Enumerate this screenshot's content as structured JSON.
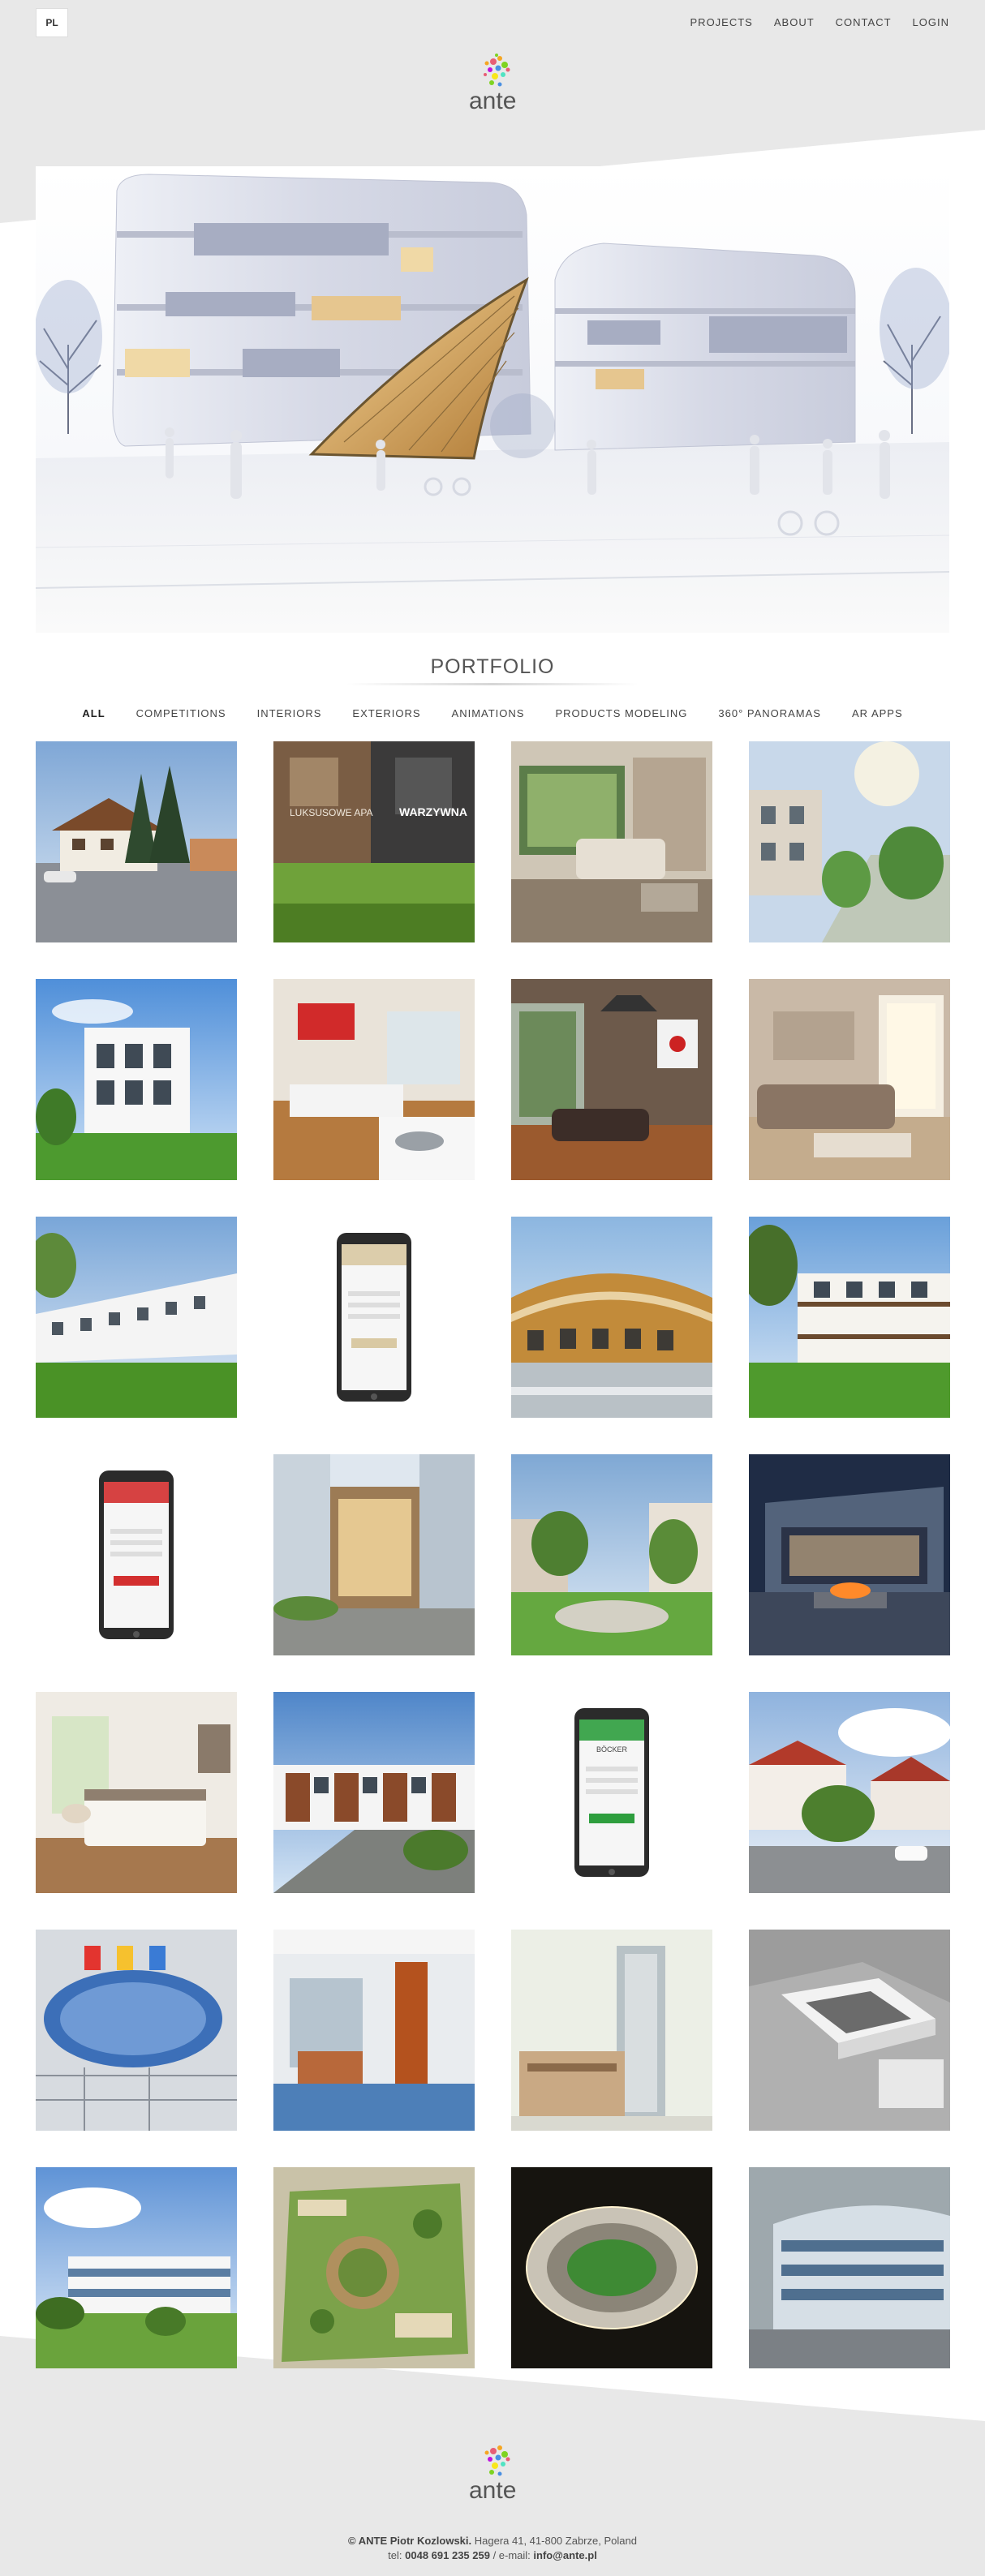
{
  "header": {
    "lang": "PL",
    "nav": [
      "PROJECTS",
      "ABOUT",
      "CONTACT",
      "LOGIN"
    ]
  },
  "logo": {
    "text": "ante"
  },
  "portfolio": {
    "title": "PORTFOLIO",
    "filters": [
      "ALL",
      "COMPETITIONS",
      "INTERIORS",
      "EXTERIORS",
      "ANIMATIONS",
      "PRODUCTS MODELING",
      "360° PANORAMAS",
      "AR APPS"
    ],
    "active_filter": "ALL"
  },
  "tiles": [
    {
      "kind": "exterior-house"
    },
    {
      "kind": "ad-banner",
      "text_left": "LUKSUSOWE APA",
      "text_right": "WARZYWNA"
    },
    {
      "kind": "interior-living"
    },
    {
      "kind": "exterior-street"
    },
    {
      "kind": "exterior-white-house"
    },
    {
      "kind": "interior-kitchen"
    },
    {
      "kind": "interior-lounge"
    },
    {
      "kind": "interior-sofa"
    },
    {
      "kind": "exterior-rowhouses"
    },
    {
      "kind": "phone-app",
      "brand_color": "#d9c9a3"
    },
    {
      "kind": "exterior-curved"
    },
    {
      "kind": "exterior-terrace"
    },
    {
      "kind": "phone-app",
      "brand_color": "#d32f2f"
    },
    {
      "kind": "exterior-office"
    },
    {
      "kind": "exterior-park"
    },
    {
      "kind": "exterior-modern-fire"
    },
    {
      "kind": "interior-bedroom"
    },
    {
      "kind": "exterior-townhouses"
    },
    {
      "kind": "phone-app",
      "brand_color": "#2e9e3e",
      "brand_text": "BÖCKER"
    },
    {
      "kind": "exterior-hillside"
    },
    {
      "kind": "exterior-glass-facade"
    },
    {
      "kind": "interior-office-hall"
    },
    {
      "kind": "exterior-tower"
    },
    {
      "kind": "exterior-aerial"
    },
    {
      "kind": "exterior-campus"
    },
    {
      "kind": "plan-garden"
    },
    {
      "kind": "stadium-night"
    },
    {
      "kind": "exterior-glass-office"
    }
  ],
  "footer": {
    "line1_bold": "© ANTE Piotr Kozlowski.",
    "line1_rest": " Hagera 41, 41-800 Zabrze, Poland",
    "line2_pre": "tel: ",
    "phone": "0048 691 235 259",
    "line2_mid": " / e-mail: ",
    "email": "info@ante.pl"
  },
  "colors": {
    "background": "#e8e8e8",
    "band": "#ffffff",
    "text": "#555555"
  }
}
